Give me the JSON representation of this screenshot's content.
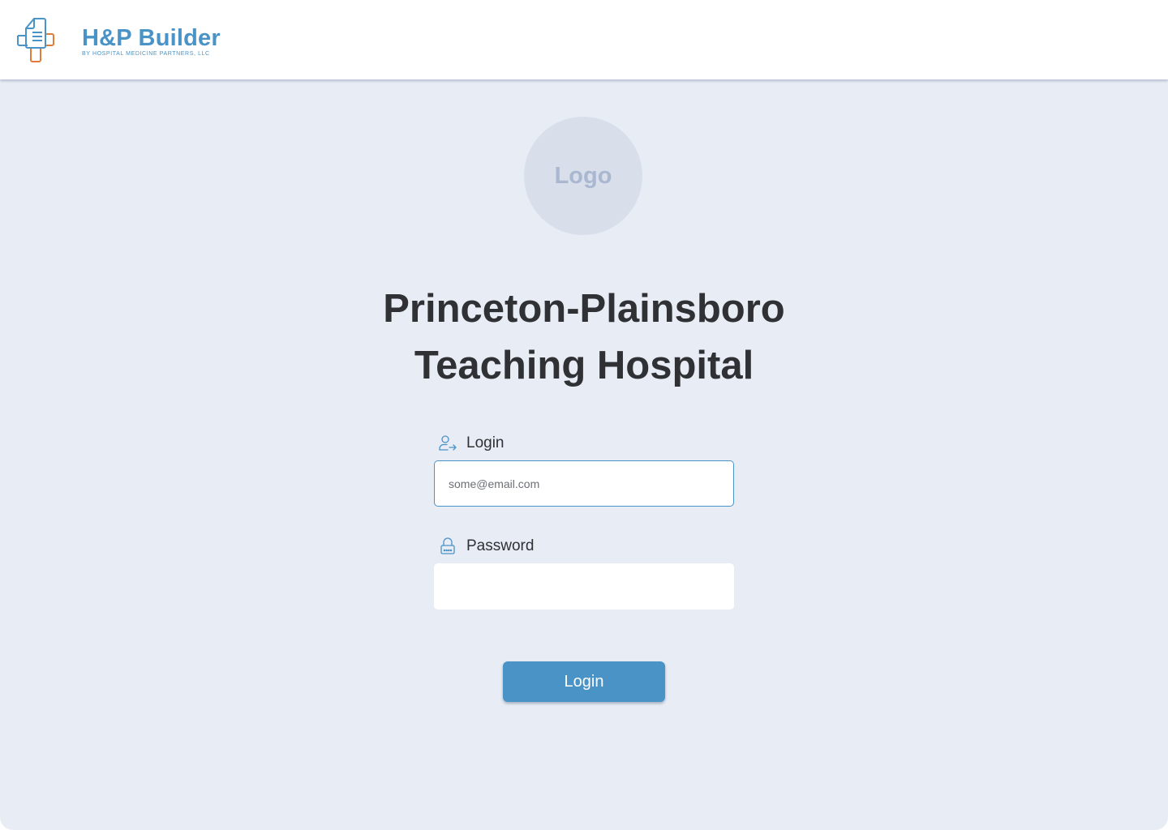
{
  "header": {
    "brand_title": "H&P Builder",
    "brand_subtitle": "BY HOSPITAL MEDICINE PARTNERS, LLC"
  },
  "logo_placeholder": "Logo",
  "hospital": {
    "name_line1": "Princeton-Plainsboro",
    "name_line2": "Teaching Hospital"
  },
  "form": {
    "login_label": "Login",
    "login_value": "some@email.com",
    "password_label": "Password",
    "password_value": "",
    "submit_label": "Login"
  },
  "colors": {
    "brand_blue": "#4a93c6",
    "brand_orange": "#e07b3a",
    "background": "#e8ecf5",
    "text": "#2f3134"
  },
  "icons": {
    "brand": "document-medical-cross-icon",
    "login": "user-arrow-icon",
    "password": "lock-icon"
  }
}
